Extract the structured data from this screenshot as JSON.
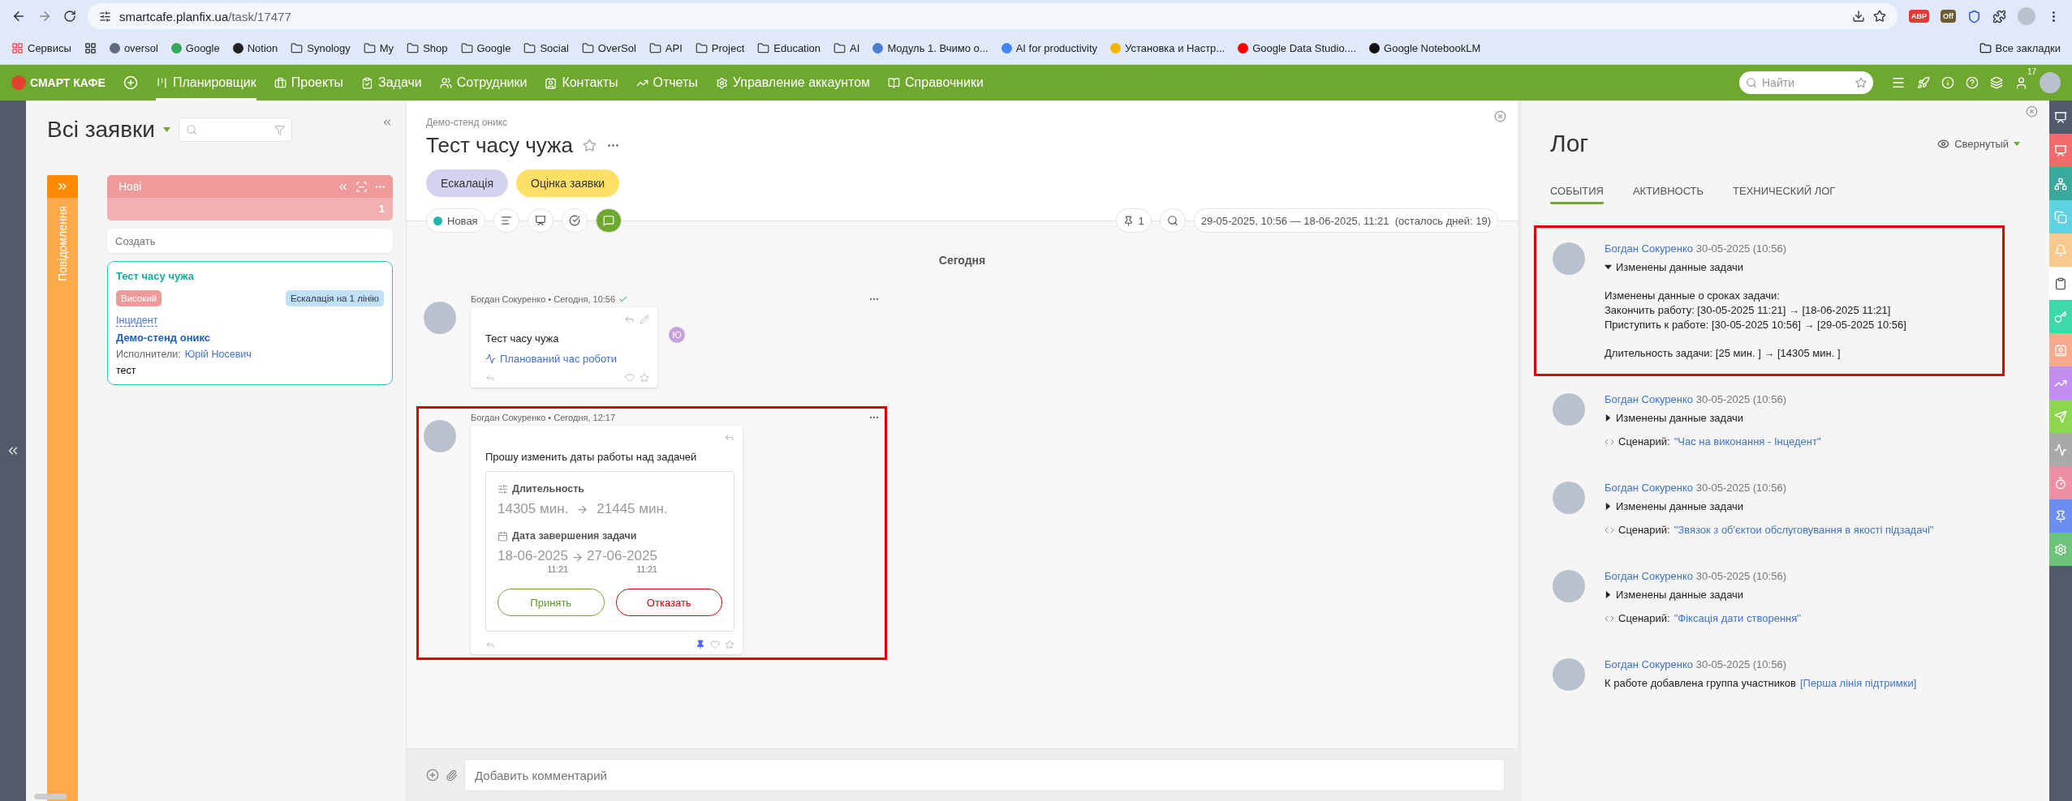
{
  "browser": {
    "address_host": "smartcafe.planfix.ua",
    "address_path": "/task/17477",
    "extensions": [
      {
        "label": "ABP",
        "color": "#e53935"
      },
      {
        "label": "Off",
        "color": "#6d5a2e"
      }
    ],
    "bookmarks": [
      {
        "label": "Сервисы",
        "kind": "apps"
      },
      {
        "label": "oversol",
        "kind": "site",
        "color": "#5f6b7a"
      },
      {
        "label": "Google",
        "kind": "site",
        "color": "#34a853"
      },
      {
        "label": "Notion",
        "kind": "site",
        "color": "#222222"
      },
      {
        "label": "Synology",
        "kind": "folder"
      },
      {
        "label": "My",
        "kind": "folder"
      },
      {
        "label": "Shop",
        "kind": "folder"
      },
      {
        "label": "Google",
        "kind": "folder"
      },
      {
        "label": "Social",
        "kind": "folder"
      },
      {
        "label": "OverSol",
        "kind": "folder"
      },
      {
        "label": "API",
        "kind": "folder"
      },
      {
        "label": "Project",
        "kind": "folder"
      },
      {
        "label": "Education",
        "kind": "folder"
      },
      {
        "label": "AI",
        "kind": "folder"
      },
      {
        "label": "Модуль 1. Вчимо о...",
        "kind": "site",
        "color": "#4a7fd0"
      },
      {
        "label": "AI for productivity",
        "kind": "site",
        "color": "#4285f4"
      },
      {
        "label": "Установка и Настр...",
        "kind": "site",
        "color": "#f4b400"
      },
      {
        "label": "Google Data Studio....",
        "kind": "site",
        "color": "#ff0000"
      },
      {
        "label": "Google NotebookLM",
        "kind": "site",
        "color": "#111111"
      }
    ],
    "all_bookmarks": "Все закладки"
  },
  "app_nav": {
    "brand": "СМАРТ КАФЕ",
    "items": [
      {
        "label": "Планировщик",
        "selected": true
      },
      {
        "label": "Проекты",
        "selected": false
      },
      {
        "label": "Задачи",
        "selected": false
      },
      {
        "label": "Сотрудники",
        "selected": false
      },
      {
        "label": "Контакты",
        "selected": false
      },
      {
        "label": "Отчеты",
        "selected": false
      },
      {
        "label": "Управление аккаунтом",
        "selected": false
      },
      {
        "label": "Справочники",
        "selected": false
      }
    ],
    "search": {
      "placeholder": "Найти"
    },
    "badge": "17"
  },
  "board": {
    "title": "Всі заявки",
    "lane": {
      "label": "Повідомлення"
    },
    "column": {
      "title": "Нові",
      "count": "1",
      "create_placeholder": "Создать",
      "cards": [
        {
          "title": "Тест часу чужа",
          "tags": [
            {
              "label": "Високий",
              "color": "#ef9a9a"
            },
            {
              "label": "Ескалація на 1 лінію",
              "color": "#bfe0f7"
            }
          ],
          "type": "Інцидент",
          "project": "Демо-стенд оникс",
          "assignee_label": "Исполнители:",
          "assignee": "Юрій Носевич",
          "note": "тест"
        }
      ]
    }
  },
  "task": {
    "breadcrumb": "Демо-стенд оникс",
    "title": "Тест часу чужа",
    "labels": [
      {
        "label": "Ескалація",
        "color": "#d4d3ef"
      },
      {
        "label": "Оцінка заявки",
        "color": "#ffe066"
      }
    ],
    "status": {
      "label": "Новая",
      "color": "#1fb5b0"
    },
    "tools": [
      {
        "selected": false
      },
      {
        "selected": false
      },
      {
        "selected": false
      },
      {
        "selected": true
      }
    ],
    "pins": "1",
    "dates": "29-05-2025, 10:56 — 18-06-2025, 11:21",
    "remaining": "(осталось дней: 19)",
    "day": "Сегодня",
    "messages": [
      {
        "author": "Богдан Сокуренко",
        "time": "Сегодня, 10:56",
        "separator": "•",
        "delivered": true,
        "highlighted": false,
        "pinned": false,
        "text": "Тест часу чужа",
        "link": "Планований час роботи",
        "read_by": "Ю"
      },
      {
        "author": "Богдан Сокуренко",
        "time": "Сегодня, 12:17",
        "separator": "•",
        "delivered": false,
        "highlighted": true,
        "pinned": true,
        "text": "Прошу изменить даты работы над задачей",
        "request": {
          "duration_label": "Длительность",
          "duration_from": "14305 мин.",
          "duration_to": "21445 мин.",
          "date_label": "Дата завершения задачи",
          "date_from": "18-06-2025",
          "time_from": "11:21",
          "date_to": "27-06-2025",
          "time_to": "11:21",
          "accept": "Принять",
          "decline": "Отказать"
        }
      }
    ],
    "comment_placeholder": "Добавить комментарий"
  },
  "log": {
    "title": "Лог",
    "view": "Свернутый",
    "tabs": [
      {
        "label": "СОБЫТИЯ",
        "selected": true
      },
      {
        "label": "АКТИВНОСТЬ",
        "selected": false
      },
      {
        "label": "ТЕХНИЧЕСКИЙ ЛОГ",
        "selected": false
      }
    ],
    "entries": [
      {
        "kind": "change",
        "author": "Богдан Сокуренко",
        "date": "30-05-2025 (10:56)",
        "summary": "Изменены данные задачи",
        "expanded": true,
        "highlighted": true,
        "details": [
          [
            "Изменены данные о сроках задачи:",
            "Закончить работу: [30-05-2025 11:21] → [18-06-2025 11:21]",
            "Приступить к работе: [30-05-2025 10:56] → [29-05-2025 10:56]"
          ],
          [
            "Длительность задачи: [25 мин. ] → [14305 мин. ]"
          ]
        ]
      },
      {
        "kind": "scenario",
        "author": "Богдан Сокуренко",
        "date": "30-05-2025 (10:56)",
        "summary": "Изменены данные задачи",
        "expanded": false,
        "highlighted": false,
        "label": "Сценарий:",
        "link": "\"Час на виконання - Інцедент\""
      },
      {
        "kind": "scenario",
        "author": "Богдан Сокуренко",
        "date": "30-05-2025 (10:56)",
        "summary": "Изменены данные задачи",
        "expanded": false,
        "highlighted": false,
        "label": "Сценарий:",
        "link": "\"Звязок з об'єктои обслуговування в якості підзадачі\""
      },
      {
        "kind": "scenario",
        "author": "Богдан Сокуренко",
        "date": "30-05-2025 (10:56)",
        "summary": "Изменены данные задачи",
        "expanded": false,
        "highlighted": false,
        "label": "Сценарий:",
        "link": "\"Фіксація дати створення\""
      },
      {
        "kind": "group",
        "author": "Богдан Сокуренко",
        "date": "30-05-2025 (10:56)",
        "highlighted": false,
        "text": "К работе добавлена группа участников",
        "link": "[Перша лінія підтримки]"
      }
    ]
  },
  "side_tools": [
    {
      "color": "#525a6e",
      "selected": false
    },
    {
      "color": "#f26b6b",
      "selected": false
    },
    {
      "color": "#3aa89a",
      "selected": false
    },
    {
      "color": "#5fd3e3",
      "selected": false
    },
    {
      "color": "#f8c98c",
      "selected": false
    },
    {
      "color": "#ffffff",
      "selected": true
    },
    {
      "color": "#3ed9a9",
      "selected": false
    },
    {
      "color": "#f9a98b",
      "selected": false
    },
    {
      "color": "#c38ef1",
      "selected": false
    },
    {
      "color": "#8fd64f",
      "selected": false
    },
    {
      "color": "#a9a9a9",
      "selected": false
    },
    {
      "color": "#ef8fa6",
      "selected": false
    },
    {
      "color": "#6b8ef0",
      "selected": false
    },
    {
      "color": "#6cc37a",
      "selected": false
    }
  ]
}
